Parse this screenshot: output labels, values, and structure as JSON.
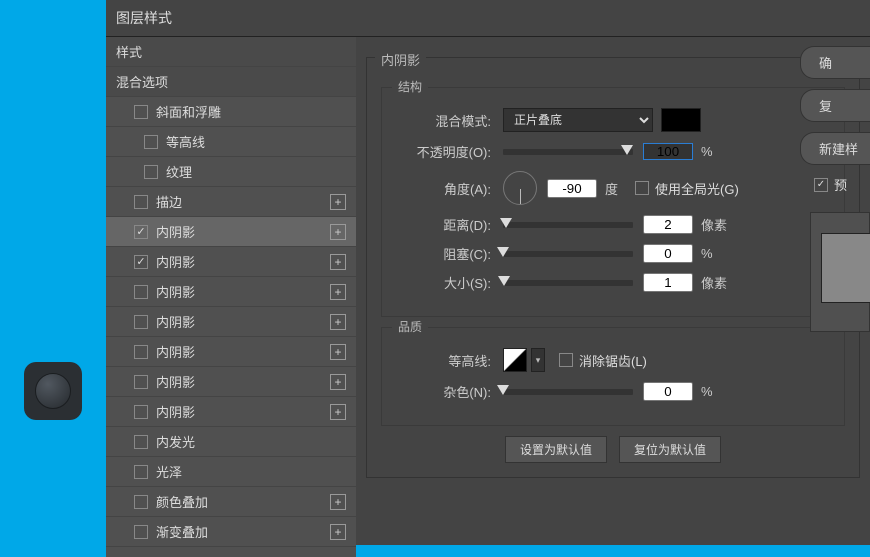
{
  "dialog": {
    "title": "图层样式"
  },
  "sidebar": {
    "heading_styles": "样式",
    "heading_blend": "混合选项",
    "bevel": "斜面和浮雕",
    "contour": "等高线",
    "texture": "纹理",
    "stroke": "描边",
    "inner_shadow": "内阴影",
    "inner_glow": "内发光",
    "satin": "光泽",
    "color_overlay": "颜色叠加",
    "gradient_overlay": "渐变叠加"
  },
  "panel": {
    "title": "内阴影",
    "structure": "结构",
    "quality": "品质",
    "blend_mode_label": "混合模式:",
    "blend_mode_value": "正片叠底",
    "opacity_label": "不透明度(O):",
    "opacity_value": "100",
    "percent": "%",
    "angle_label": "角度(A):",
    "angle_value": "-90",
    "degree": "度",
    "global_light": "使用全局光(G)",
    "distance_label": "距离(D):",
    "distance_value": "2",
    "px": "像素",
    "choke_label": "阻塞(C):",
    "choke_value": "0",
    "size_label": "大小(S):",
    "size_value": "1",
    "contour_label": "等高线:",
    "antialias": "消除锯齿(L)",
    "noise_label": "杂色(N):",
    "noise_value": "0",
    "btn_default": "设置为默认值",
    "btn_reset": "复位为默认值"
  },
  "right": {
    "ok": "确",
    "cancel": "复",
    "new_style": "新建样",
    "preview": "预"
  }
}
